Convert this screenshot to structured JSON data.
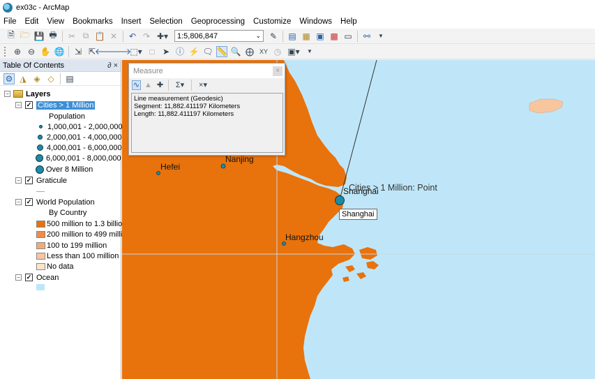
{
  "window": {
    "title": "ex03c - ArcMap"
  },
  "menu": [
    "File",
    "Edit",
    "View",
    "Bookmarks",
    "Insert",
    "Selection",
    "Geoprocessing",
    "Customize",
    "Windows",
    "Help"
  ],
  "toolbar": {
    "scale": "1:5,806,847"
  },
  "toc": {
    "title": "Table Of Contents",
    "pin": "∂ ×",
    "root": "Layers",
    "cities": {
      "label": "Cities > 1 Million",
      "field": "Population",
      "classes": [
        "1,000,001 - 2,000,000",
        "2,000,001 - 4,000,000",
        "4,000,001 - 6,000,000",
        "6,000,001 - 8,000,000",
        "Over 8 Million"
      ]
    },
    "graticule": "Graticule",
    "world": {
      "label": "World Population",
      "field": "By Country",
      "classes": [
        {
          "label": "500 million to 1.3 billio",
          "color": "#e8720c"
        },
        {
          "label": "200 million to 499 milli",
          "color": "#f08c46"
        },
        {
          "label": "100 to 199 million",
          "color": "#f4aa78"
        },
        {
          "label": "Less than 100 million",
          "color": "#f7c69f"
        },
        {
          "label": "No data",
          "color": "#fbe4c8"
        }
      ]
    },
    "ocean": {
      "label": "Ocean",
      "color": "#bfe6f8"
    }
  },
  "map": {
    "land_color": "#e8720c",
    "ocean_color": "#bfe6f8",
    "cities": [
      "Hefei",
      "Nanjing",
      "Shanghai",
      "Hangzhou"
    ],
    "overlay_text": "Cities > 1 Million: Point",
    "tooltip": "Shanghai"
  },
  "measure": {
    "title": "Measure",
    "close": "×",
    "lines": [
      "Line measurement (Geodesic)",
      "Segment: 11,882.411197 Kilometers",
      "Length: 11,882.411197 Kilometers"
    ]
  }
}
